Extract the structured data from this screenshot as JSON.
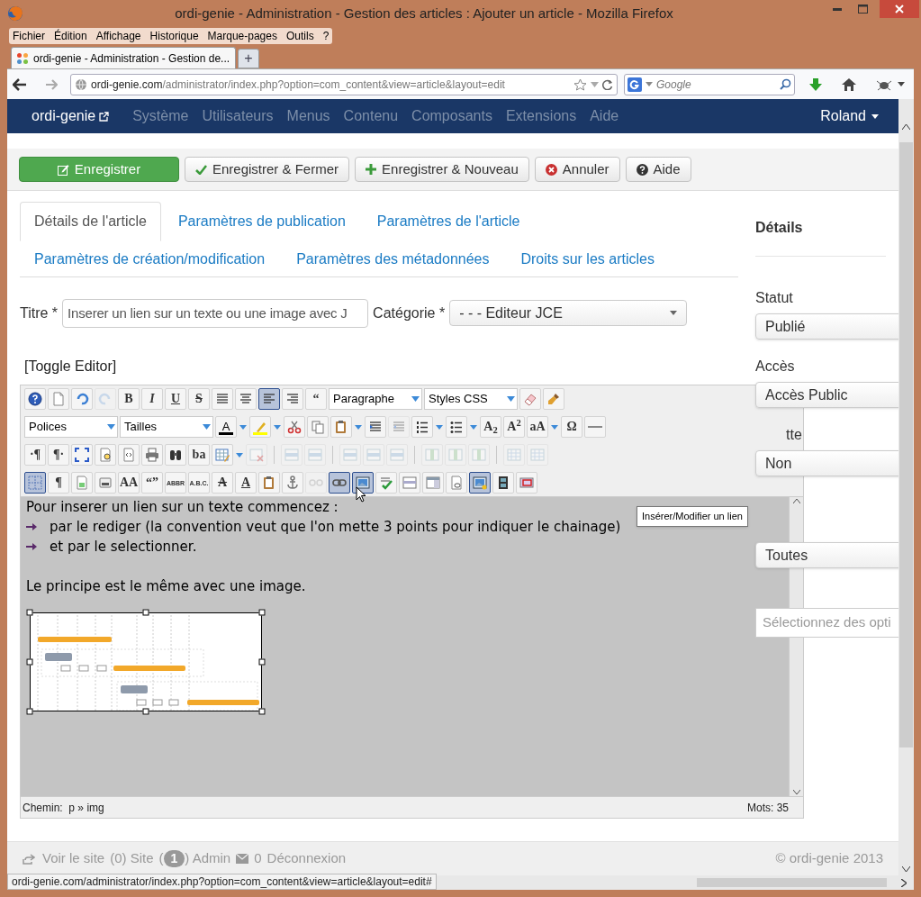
{
  "browser": {
    "title": "ordi-genie - Administration - Gestion des articles : Ajouter un article - Mozilla Firefox",
    "menu": [
      "Fichier",
      "Édition",
      "Affichage",
      "Historique",
      "Marque-pages",
      "Outils",
      "?"
    ],
    "tab": {
      "label": "ordi-genie - Administration - Gestion de...",
      "selected": true
    },
    "new_tab": "+",
    "url_host": "ordi-genie.com",
    "url_path": "/administrator/index.php?option=com_content&view=article&layout=edit",
    "search_placeholder": "Google",
    "status_url": "ordi-genie.com/administrator/index.php?option=com_content&view=article&layout=edit#"
  },
  "admin_nav": {
    "brand": "ordi-genie",
    "items": [
      "Système",
      "Utilisateurs",
      "Menus",
      "Contenu",
      "Composants",
      "Extensions",
      "Aide"
    ],
    "user": "Roland"
  },
  "actions": [
    {
      "label": "Enregistrer",
      "kind": "primary"
    },
    {
      "label": "Enregistrer & Fermer",
      "kind": "check"
    },
    {
      "label": "Enregistrer & Nouveau",
      "kind": "plus"
    },
    {
      "label": "Annuler",
      "kind": "cancel"
    },
    {
      "label": "Aide",
      "kind": "help"
    }
  ],
  "tabs": [
    [
      {
        "label": "Détails de l'article",
        "selected": true
      },
      {
        "label": "Paramètres de publication",
        "selected": false
      },
      {
        "label": "Paramètres de l'article",
        "selected": false
      }
    ],
    [
      {
        "label": "Paramètres de création/modification",
        "selected": false
      },
      {
        "label": "Paramètres des métadonnées",
        "selected": false
      },
      {
        "label": "Droits sur les articles",
        "selected": false
      }
    ]
  ],
  "title_field": {
    "label": "Titre *",
    "value": "Inserer un lien sur un texte ou une image avec J"
  },
  "category": {
    "label": "Catégorie *",
    "value": "- - - Editeur JCE"
  },
  "toggle_editor": "[Toggle Editor]",
  "editor": {
    "toolbar": [
      [
        {
          "kind": "icon",
          "selected": false,
          "disabled": false
        },
        {
          "kind": "icon",
          "selected": false,
          "disabled": false
        },
        {
          "kind": "icon",
          "selected": false,
          "disabled": false
        },
        {
          "kind": "icon",
          "selected": false,
          "disabled": true
        },
        {
          "kind": "glyph",
          "text": "B",
          "selected": false,
          "disabled": false
        },
        {
          "kind": "glyph",
          "text": "I",
          "selected": false,
          "disabled": false
        },
        {
          "kind": "glyph",
          "text": "U",
          "selected": false,
          "disabled": false
        },
        {
          "kind": "glyph",
          "text": "S",
          "selected": false,
          "disabled": false
        },
        {
          "kind": "icon",
          "selected": false,
          "disabled": false
        },
        {
          "kind": "icon",
          "selected": false,
          "disabled": false
        },
        {
          "kind": "icon",
          "selected": true,
          "disabled": false
        },
        {
          "kind": "icon",
          "selected": false,
          "disabled": false
        },
        {
          "kind": "glyph",
          "text": "“",
          "selected": false,
          "disabled": false
        },
        {
          "kind": "select",
          "text": "Paragraphe"
        },
        {
          "kind": "select",
          "text": "Styles CSS"
        },
        {
          "kind": "icon",
          "selected": false,
          "disabled": false
        },
        {
          "kind": "icon",
          "selected": false,
          "disabled": false
        }
      ],
      [
        {
          "kind": "select",
          "text": "Polices"
        },
        {
          "kind": "select",
          "text": "Tailles"
        },
        {
          "kind": "color",
          "text": "A",
          "color": "#000000"
        },
        {
          "kind": "split"
        },
        {
          "kind": "color",
          "color": "#ffff00"
        },
        {
          "kind": "split"
        },
        {
          "kind": "icon",
          "selected": false,
          "disabled": false
        },
        {
          "kind": "icon",
          "selected": false,
          "disabled": false
        },
        {
          "kind": "icon",
          "selected": false,
          "disabled": false
        },
        {
          "kind": "split"
        },
        {
          "kind": "icon",
          "selected": false,
          "disabled": false
        },
        {
          "kind": "icon",
          "selected": false,
          "disabled": true
        },
        {
          "kind": "icon",
          "selected": false,
          "disabled": false
        },
        {
          "kind": "split"
        },
        {
          "kind": "icon",
          "selected": false,
          "disabled": false
        },
        {
          "kind": "split"
        },
        {
          "kind": "glyph",
          "text": "A$_{2}$",
          "selected": false,
          "disabled": false
        },
        {
          "kind": "glyph",
          "text": "A$^{2}$",
          "selected": false,
          "disabled": false
        },
        {
          "kind": "glyph",
          "text": "aA",
          "selected": false,
          "disabled": false
        },
        {
          "kind": "split"
        },
        {
          "kind": "glyph",
          "text": "Ω",
          "selected": false,
          "disabled": false
        },
        {
          "kind": "icon",
          "selected": false,
          "disabled": false
        }
      ],
      [
        {
          "kind": "glyph",
          "text": "·¶",
          "selected": false,
          "disabled": false
        },
        {
          "kind": "glyph",
          "text": "¶·",
          "selected": false,
          "disabled": false
        },
        {
          "kind": "icon",
          "selected": false,
          "disabled": false
        },
        {
          "kind": "icon",
          "selected": false,
          "disabled": false
        },
        {
          "kind": "icon",
          "selected": false,
          "disabled": false
        },
        {
          "kind": "icon",
          "selected": false,
          "disabled": false
        },
        {
          "kind": "icon",
          "selected": false,
          "disabled": false
        },
        {
          "kind": "glyph",
          "text": "ba",
          "selected": false,
          "disabled": false
        },
        {
          "kind": "icon",
          "selected": false,
          "disabled": false
        },
        {
          "kind": "split"
        },
        {
          "kind": "icon",
          "selected": false,
          "disabled": true
        },
        {
          "kind": "sep"
        },
        {
          "kind": "icon",
          "selected": false,
          "disabled": true
        },
        {
          "kind": "icon",
          "selected": false,
          "disabled": true
        },
        {
          "kind": "sep"
        },
        {
          "kind": "icon",
          "selected": false,
          "disabled": true
        },
        {
          "kind": "icon",
          "selected": false,
          "disabled": true
        },
        {
          "kind": "icon",
          "selected": false,
          "disabled": true
        },
        {
          "kind": "sep"
        },
        {
          "kind": "icon",
          "selected": false,
          "disabled": true
        },
        {
          "kind": "icon",
          "selected": false,
          "disabled": true
        },
        {
          "kind": "icon",
          "selected": false,
          "disabled": true
        },
        {
          "kind": "sep"
        },
        {
          "kind": "icon",
          "selected": false,
          "disabled": true
        },
        {
          "kind": "icon",
          "selected": false,
          "disabled": true
        }
      ],
      [
        {
          "kind": "icon",
          "selected": true,
          "disabled": false
        },
        {
          "kind": "glyph",
          "text": "¶",
          "selected": false,
          "disabled": false
        },
        {
          "kind": "icon",
          "selected": false,
          "disabled": false
        },
        {
          "kind": "icon",
          "selected": false,
          "disabled": false
        },
        {
          "kind": "glyph",
          "text": "AA",
          "selected": false,
          "disabled": false
        },
        {
          "kind": "glyph",
          "text": "“”",
          "selected": false,
          "disabled": false
        },
        {
          "kind": "glyph",
          "text": "ABBR",
          "selected": false,
          "disabled": false
        },
        {
          "kind": "glyph",
          "text": "A.B.C.",
          "selected": false,
          "disabled": false
        },
        {
          "kind": "glyph",
          "text": "A",
          "selected": false,
          "disabled": false
        },
        {
          "kind": "glyph",
          "text": "A",
          "selected": false,
          "disabled": false
        },
        {
          "kind": "icon",
          "selected": false,
          "disabled": false
        },
        {
          "kind": "icon",
          "selected": false,
          "disabled": false
        },
        {
          "kind": "icon",
          "selected": false,
          "disabled": true
        },
        {
          "kind": "icon",
          "selected": true,
          "disabled": false
        },
        {
          "kind": "icon",
          "selected": true,
          "disabled": false
        },
        {
          "kind": "icon",
          "selected": false,
          "disabled": false
        },
        {
          "kind": "icon",
          "selected": false,
          "disabled": false
        },
        {
          "kind": "icon",
          "selected": false,
          "disabled": false
        },
        {
          "kind": "icon",
          "selected": false,
          "disabled": false
        },
        {
          "kind": "icon",
          "selected": true,
          "disabled": false
        },
        {
          "kind": "icon",
          "selected": false,
          "disabled": false
        },
        {
          "kind": "icon",
          "selected": false,
          "disabled": false
        }
      ]
    ],
    "content": {
      "intro": "Pour inserer un lien sur un texte commencez :",
      "bullets": [
        "par le rediger (la convention veut que l'on mette 3 points pour indiquer le chainage)",
        "et par le selectionner."
      ],
      "paragraph": "Le principe est le même avec une image.",
      "image": {
        "kind": "picture",
        "selected": true
      }
    },
    "tooltip": "Insérer/Modifier un lien",
    "path_label": "Chemin:",
    "path": "p » img",
    "word_count": "Mots: 35"
  },
  "sidebar": {
    "heading": "Détails",
    "fields": [
      {
        "kind": "select",
        "label": "Statut",
        "value": "Publié"
      },
      {
        "kind": "select",
        "label": "Accès",
        "value": "Accès Public"
      },
      {
        "kind": "select",
        "label": "tte",
        "value": "Non"
      },
      {
        "kind": "select",
        "value": "Toutes"
      },
      {
        "kind": "multi",
        "placeholder": "Sélectionnez des opti"
      }
    ]
  },
  "footer": {
    "view_site": "Voir le site",
    "site": "(0) Site",
    "paren_open": "(",
    "admin_badge": "1",
    "admin": ") Admin",
    "messages": "0",
    "logout": "Déconnexion",
    "copyright": "© ordi-genie 2013"
  }
}
